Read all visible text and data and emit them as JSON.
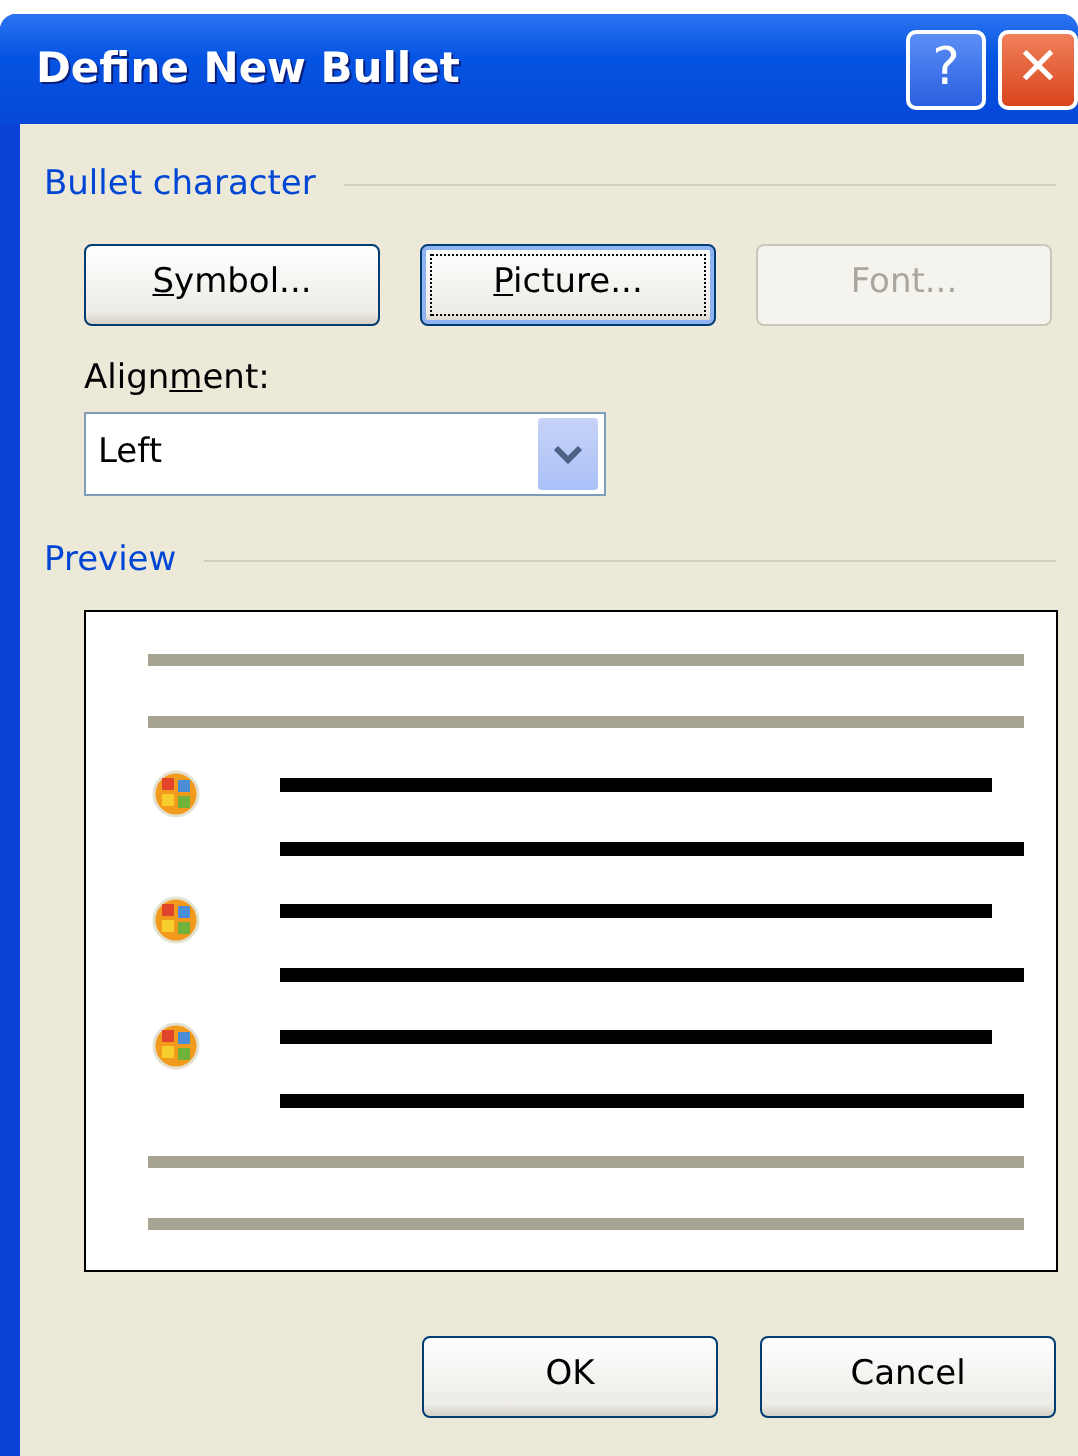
{
  "window": {
    "title": "Define New Bullet",
    "title_buttons": [
      {
        "kind": "help",
        "glyph": "?"
      },
      {
        "kind": "close",
        "glyph": "✕"
      }
    ]
  },
  "bullet_character": {
    "heading": "Bullet character",
    "buttons": [
      {
        "key": "S",
        "post": "ymbol...",
        "disabled": false,
        "focused": false
      },
      {
        "key": "P",
        "post": "icture...",
        "disabled": false,
        "focused": true
      },
      {
        "pre": "Font...",
        "disabled": true,
        "focused": false
      }
    ],
    "alignment": {
      "pre": "Align",
      "key": "m",
      "post": "ent:",
      "value": "Left"
    }
  },
  "preview": {
    "heading": "Preview",
    "paragraphs": [
      {
        "kind": "plain"
      },
      {
        "kind": "plain"
      },
      {
        "kind": "bulleted"
      },
      {
        "kind": "bulleted"
      },
      {
        "kind": "bulleted"
      },
      {
        "kind": "plain"
      },
      {
        "kind": "plain"
      }
    ]
  },
  "buttons": [
    {
      "label": "OK"
    },
    {
      "label": "Cancel"
    }
  ]
}
